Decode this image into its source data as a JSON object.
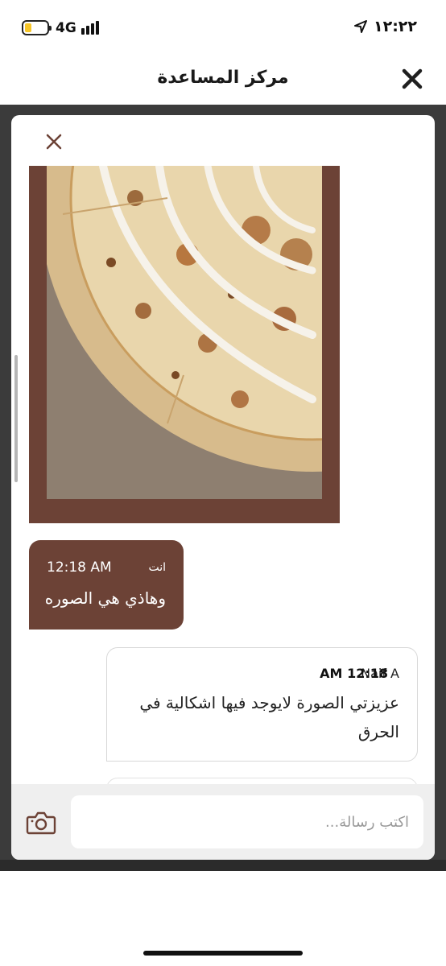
{
  "status_bar": {
    "network": "4G",
    "time": "١٢:٢٢",
    "icons": [
      "battery-icon",
      "signal-icon",
      "location-arrow-icon"
    ]
  },
  "header": {
    "title": "مركز المساعدة",
    "close_icon": "close-icon"
  },
  "chat": {
    "image_message": {
      "image": "pizza-photo",
      "accent_color": "#6c4236"
    },
    "outgoing_message": {
      "sender": "انت",
      "time": "12:18 AM",
      "text": "وهاذي هي الصوره",
      "bubble_color": "#6c4236"
    },
    "incoming_message": {
      "sender": "Naif A",
      "time": "12:18 AM",
      "text": "عزيزتي الصورة لايوجد فيها اشكالية في الحرق"
    }
  },
  "composer": {
    "placeholder": "اكتب رسالة...",
    "camera_icon": "camera-icon"
  }
}
